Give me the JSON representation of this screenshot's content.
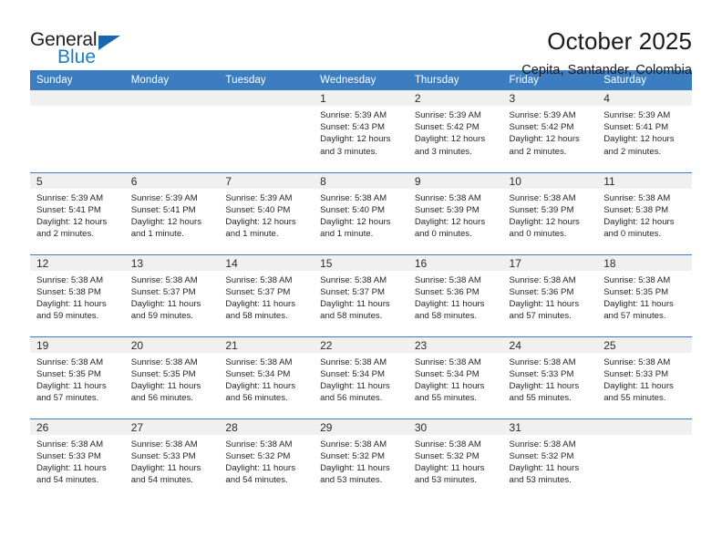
{
  "brand": {
    "name_line1": "General",
    "name_line2": "Blue",
    "logo_icon": "triangle-icon",
    "color_dark": "#231f20",
    "color_blue": "#1d7dc4"
  },
  "header": {
    "title": "October 2025",
    "subtitle": "Cepita, Santander, Colombia"
  },
  "theme": {
    "header_bg": "#3b7dc0",
    "daynum_bg": "#f0f0f0",
    "cell_bg": "#ffffff",
    "text": "#262626"
  },
  "weekdays": [
    "Sunday",
    "Monday",
    "Tuesday",
    "Wednesday",
    "Thursday",
    "Friday",
    "Saturday"
  ],
  "weeks": [
    [
      {
        "day": "",
        "blank": true
      },
      {
        "day": "",
        "blank": true
      },
      {
        "day": "",
        "blank": true
      },
      {
        "day": "1",
        "sunrise": "Sunrise: 5:39 AM",
        "sunset": "Sunset: 5:43 PM",
        "daylight": "Daylight: 12 hours and 3 minutes."
      },
      {
        "day": "2",
        "sunrise": "Sunrise: 5:39 AM",
        "sunset": "Sunset: 5:42 PM",
        "daylight": "Daylight: 12 hours and 3 minutes."
      },
      {
        "day": "3",
        "sunrise": "Sunrise: 5:39 AM",
        "sunset": "Sunset: 5:42 PM",
        "daylight": "Daylight: 12 hours and 2 minutes."
      },
      {
        "day": "4",
        "sunrise": "Sunrise: 5:39 AM",
        "sunset": "Sunset: 5:41 PM",
        "daylight": "Daylight: 12 hours and 2 minutes."
      }
    ],
    [
      {
        "day": "5",
        "sunrise": "Sunrise: 5:39 AM",
        "sunset": "Sunset: 5:41 PM",
        "daylight": "Daylight: 12 hours and 2 minutes."
      },
      {
        "day": "6",
        "sunrise": "Sunrise: 5:39 AM",
        "sunset": "Sunset: 5:41 PM",
        "daylight": "Daylight: 12 hours and 1 minute."
      },
      {
        "day": "7",
        "sunrise": "Sunrise: 5:39 AM",
        "sunset": "Sunset: 5:40 PM",
        "daylight": "Daylight: 12 hours and 1 minute."
      },
      {
        "day": "8",
        "sunrise": "Sunrise: 5:38 AM",
        "sunset": "Sunset: 5:40 PM",
        "daylight": "Daylight: 12 hours and 1 minute."
      },
      {
        "day": "9",
        "sunrise": "Sunrise: 5:38 AM",
        "sunset": "Sunset: 5:39 PM",
        "daylight": "Daylight: 12 hours and 0 minutes."
      },
      {
        "day": "10",
        "sunrise": "Sunrise: 5:38 AM",
        "sunset": "Sunset: 5:39 PM",
        "daylight": "Daylight: 12 hours and 0 minutes."
      },
      {
        "day": "11",
        "sunrise": "Sunrise: 5:38 AM",
        "sunset": "Sunset: 5:38 PM",
        "daylight": "Daylight: 12 hours and 0 minutes."
      }
    ],
    [
      {
        "day": "12",
        "sunrise": "Sunrise: 5:38 AM",
        "sunset": "Sunset: 5:38 PM",
        "daylight": "Daylight: 11 hours and 59 minutes."
      },
      {
        "day": "13",
        "sunrise": "Sunrise: 5:38 AM",
        "sunset": "Sunset: 5:37 PM",
        "daylight": "Daylight: 11 hours and 59 minutes."
      },
      {
        "day": "14",
        "sunrise": "Sunrise: 5:38 AM",
        "sunset": "Sunset: 5:37 PM",
        "daylight": "Daylight: 11 hours and 58 minutes."
      },
      {
        "day": "15",
        "sunrise": "Sunrise: 5:38 AM",
        "sunset": "Sunset: 5:37 PM",
        "daylight": "Daylight: 11 hours and 58 minutes."
      },
      {
        "day": "16",
        "sunrise": "Sunrise: 5:38 AM",
        "sunset": "Sunset: 5:36 PM",
        "daylight": "Daylight: 11 hours and 58 minutes."
      },
      {
        "day": "17",
        "sunrise": "Sunrise: 5:38 AM",
        "sunset": "Sunset: 5:36 PM",
        "daylight": "Daylight: 11 hours and 57 minutes."
      },
      {
        "day": "18",
        "sunrise": "Sunrise: 5:38 AM",
        "sunset": "Sunset: 5:35 PM",
        "daylight": "Daylight: 11 hours and 57 minutes."
      }
    ],
    [
      {
        "day": "19",
        "sunrise": "Sunrise: 5:38 AM",
        "sunset": "Sunset: 5:35 PM",
        "daylight": "Daylight: 11 hours and 57 minutes."
      },
      {
        "day": "20",
        "sunrise": "Sunrise: 5:38 AM",
        "sunset": "Sunset: 5:35 PM",
        "daylight": "Daylight: 11 hours and 56 minutes."
      },
      {
        "day": "21",
        "sunrise": "Sunrise: 5:38 AM",
        "sunset": "Sunset: 5:34 PM",
        "daylight": "Daylight: 11 hours and 56 minutes."
      },
      {
        "day": "22",
        "sunrise": "Sunrise: 5:38 AM",
        "sunset": "Sunset: 5:34 PM",
        "daylight": "Daylight: 11 hours and 56 minutes."
      },
      {
        "day": "23",
        "sunrise": "Sunrise: 5:38 AM",
        "sunset": "Sunset: 5:34 PM",
        "daylight": "Daylight: 11 hours and 55 minutes."
      },
      {
        "day": "24",
        "sunrise": "Sunrise: 5:38 AM",
        "sunset": "Sunset: 5:33 PM",
        "daylight": "Daylight: 11 hours and 55 minutes."
      },
      {
        "day": "25",
        "sunrise": "Sunrise: 5:38 AM",
        "sunset": "Sunset: 5:33 PM",
        "daylight": "Daylight: 11 hours and 55 minutes."
      }
    ],
    [
      {
        "day": "26",
        "sunrise": "Sunrise: 5:38 AM",
        "sunset": "Sunset: 5:33 PM",
        "daylight": "Daylight: 11 hours and 54 minutes."
      },
      {
        "day": "27",
        "sunrise": "Sunrise: 5:38 AM",
        "sunset": "Sunset: 5:33 PM",
        "daylight": "Daylight: 11 hours and 54 minutes."
      },
      {
        "day": "28",
        "sunrise": "Sunrise: 5:38 AM",
        "sunset": "Sunset: 5:32 PM",
        "daylight": "Daylight: 11 hours and 54 minutes."
      },
      {
        "day": "29",
        "sunrise": "Sunrise: 5:38 AM",
        "sunset": "Sunset: 5:32 PM",
        "daylight": "Daylight: 11 hours and 53 minutes."
      },
      {
        "day": "30",
        "sunrise": "Sunrise: 5:38 AM",
        "sunset": "Sunset: 5:32 PM",
        "daylight": "Daylight: 11 hours and 53 minutes."
      },
      {
        "day": "31",
        "sunrise": "Sunrise: 5:38 AM",
        "sunset": "Sunset: 5:32 PM",
        "daylight": "Daylight: 11 hours and 53 minutes."
      },
      {
        "day": "",
        "blank": true
      }
    ]
  ]
}
